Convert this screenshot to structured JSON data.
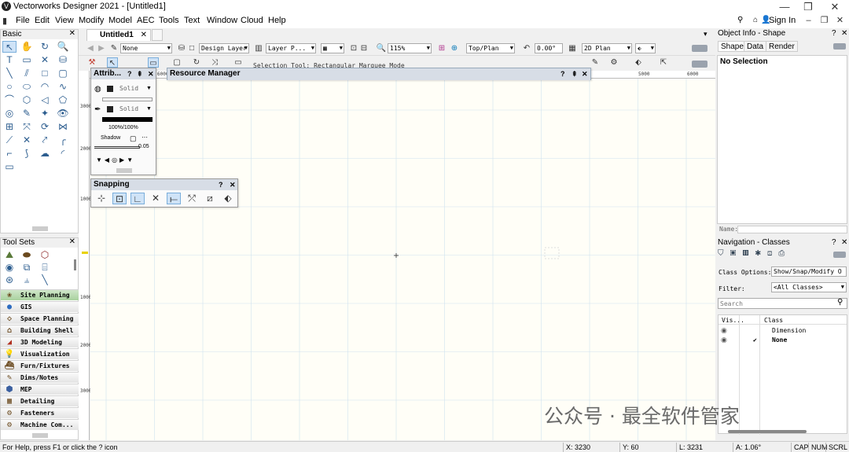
{
  "window": {
    "title": "Vectorworks Designer 2021 - [Untitled1]"
  },
  "menu": [
    "File",
    "Edit",
    "View",
    "Modify",
    "Model",
    "AEC",
    "Tools",
    "Text",
    "Window",
    "Cloud",
    "Help"
  ],
  "account": {
    "sign_in": "Sign In"
  },
  "basic_palette": {
    "title": "Basic"
  },
  "tool_sets": {
    "title": "Tool Sets",
    "items": [
      "Site Planning",
      "GIS",
      "Space Planning",
      "Building Shell",
      "3D Modeling",
      "Visualization",
      "Furn/Fixtures",
      "Dims/Notes",
      "MEP",
      "Detailing",
      "Fasteners",
      "Machine Com..."
    ]
  },
  "doc_tab": {
    "label": "Untitled1"
  },
  "view_bar": {
    "class": "None",
    "layer": "Design Layer",
    "layer_name": "Layer P...",
    "zoom": "115%",
    "view": "Top/Plan",
    "rotation": "0.00°",
    "render": "2D Plan"
  },
  "mode_bar": {
    "text": "Selection Tool: Rectangular Marquee Mode"
  },
  "ruler": {
    "top": [
      "6000",
      "5000",
      "6000"
    ],
    "left": [
      "3000",
      "2000",
      "1000",
      "1000",
      "2000",
      "3000"
    ]
  },
  "attributes": {
    "title": "Attrib...",
    "fill_style": "Solid",
    "pen_style": "Solid",
    "opacity": "100%/100%",
    "shadow_label": "Shadow",
    "line_weight": "0.05"
  },
  "resource_manager": {
    "title": "Resource Manager"
  },
  "snapping": {
    "title": "Snapping"
  },
  "object_info": {
    "title": "Object Info - Shape",
    "tabs": [
      "Shape",
      "Data",
      "Render"
    ],
    "selection": "No Selection",
    "name_label": "Name:"
  },
  "navigation": {
    "title": "Navigation - Classes",
    "class_options_label": "Class Options:",
    "class_options_value": "Show/Snap/Modify O",
    "filter_label": "Filter:",
    "filter_value": "<All Classes>",
    "search_placeholder": "Search",
    "columns": [
      "Vis...",
      "Class"
    ],
    "rows": [
      {
        "name": "Dimension",
        "active": ""
      },
      {
        "name": "None",
        "active": "✔"
      }
    ]
  },
  "status": {
    "help": "For Help, press F1 or click the ? icon",
    "x": "X: 3230",
    "y": "Y: 60",
    "l": "L: 3231",
    "a": "A: 1.06°",
    "cap": "CAP",
    "num": "NUM",
    "scrl": "SCRL"
  },
  "watermark": "公众号 · 最全软件管家"
}
